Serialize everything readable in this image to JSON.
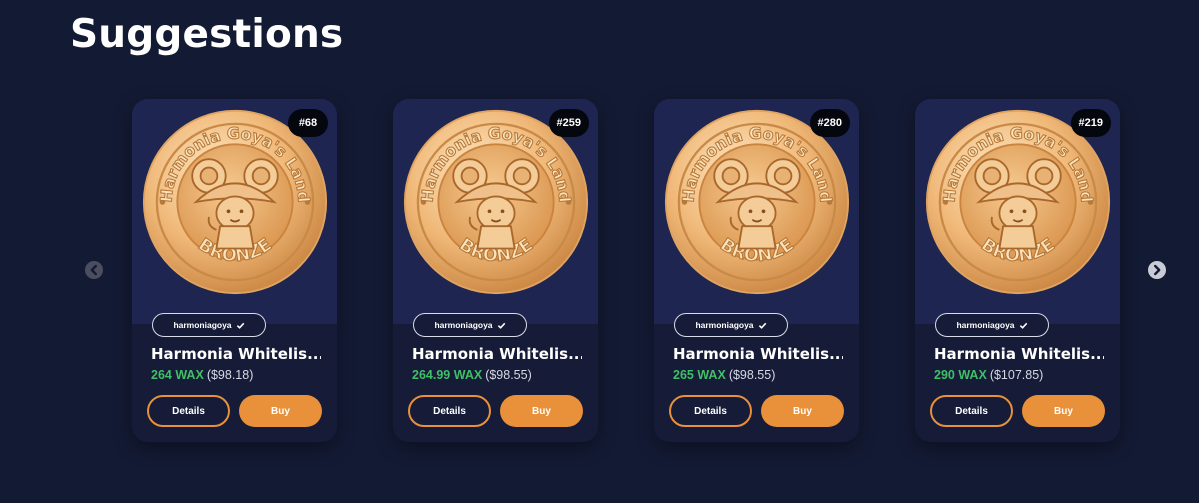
{
  "page": {
    "title": "Suggestions"
  },
  "colors": {
    "background": "#131a33",
    "card": "#1c2244",
    "accent": "#e8903a",
    "price_green": "#3fc066"
  },
  "carousel": {
    "prev_icon": "chevron-left-icon",
    "next_icon": "chevron-right-icon"
  },
  "cards": [
    {
      "badge": "#68",
      "creator": "harmoniagoya",
      "name": "Harmonia Whitelis...",
      "price_wax": "264 WAX",
      "price_usd": "($98.18)",
      "details_label": "Details",
      "buy_label": "Buy",
      "coin_text_top": "Harmonia Goya's Land",
      "coin_text_bottom": "BRONZE"
    },
    {
      "badge": "#259",
      "creator": "harmoniagoya",
      "name": "Harmonia Whitelis...",
      "price_wax": "264.99 WAX",
      "price_usd": "($98.55)",
      "details_label": "Details",
      "buy_label": "Buy",
      "coin_text_top": "Harmonia Goya's Land",
      "coin_text_bottom": "BRONZE"
    },
    {
      "badge": "#280",
      "creator": "harmoniagoya",
      "name": "Harmonia Whitelis...",
      "price_wax": "265 WAX",
      "price_usd": "($98.55)",
      "details_label": "Details",
      "buy_label": "Buy",
      "coin_text_top": "Harmonia Goya's Land",
      "coin_text_bottom": "BRONZE"
    },
    {
      "badge": "#219",
      "creator": "harmoniagoya",
      "name": "Harmonia Whitelis...",
      "price_wax": "290 WAX",
      "price_usd": "($107.85)",
      "details_label": "Details",
      "buy_label": "Buy",
      "coin_text_top": "Harmonia Goya's Land",
      "coin_text_bottom": "BRONZE"
    }
  ]
}
